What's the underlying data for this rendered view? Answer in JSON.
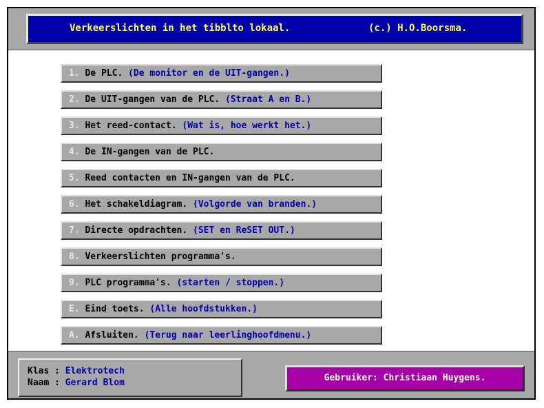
{
  "header": {
    "title": "Verkeerslichten in het tibblto lokaal.",
    "copyright": "(c.) H.O.Boorsma."
  },
  "menu": [
    {
      "key": "1.",
      "label": "De PLC.",
      "hint": "(De monitor en de UIT-gangen.)"
    },
    {
      "key": "2.",
      "label": "De UIT-gangen van de PLC.",
      "hint": "(Straat A en B.)"
    },
    {
      "key": "3.",
      "label": "Het reed-contact.",
      "hint": "(Wat is, hoe werkt het.)"
    },
    {
      "key": "4.",
      "label": "De IN-gangen van de PLC.",
      "hint": ""
    },
    {
      "key": "5.",
      "label": "Reed contacten en IN-gangen van de PLC.",
      "hint": ""
    },
    {
      "key": "6.",
      "label": "Het schakeldiagram.",
      "hint": "(Volgorde van branden.)"
    },
    {
      "key": "7.",
      "label": "Directe opdrachten.",
      "hint": "(SET en ReSET OUT.)"
    },
    {
      "key": "8.",
      "label": "Verkeerslichten programma's.",
      "hint": ""
    },
    {
      "key": "9.",
      "label": "PLC programma's.",
      "hint": "(starten / stoppen.)"
    },
    {
      "key": "E.",
      "label": "Eind toets.",
      "hint": "(Alle hoofdstukken.)"
    },
    {
      "key": "A.",
      "label": "Afsluiten.",
      "hint": "(Terug naar leerlinghoofdmenu.)"
    }
  ],
  "info": {
    "klas_label": "Klas : ",
    "klas_value": "Elektrotech",
    "naam_label": "Naam : ",
    "naam_value": "Gerard Blom"
  },
  "user": {
    "text": "Gebruiker: Christiaan Huygens."
  },
  "colors": {
    "panel": "#a8a8a8",
    "title_bg": "#0000a8",
    "title_fg": "#ffff54",
    "hint": "#0000a8",
    "user_bg": "#a800a8"
  }
}
